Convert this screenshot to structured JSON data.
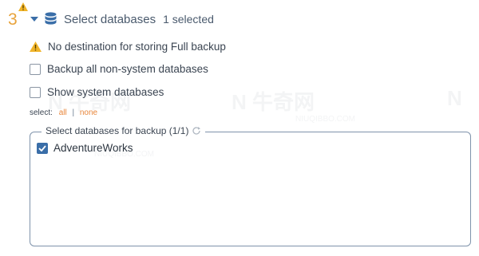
{
  "step": {
    "number": "3",
    "title": "Select databases",
    "subtitle": "1 selected"
  },
  "warning": {
    "text": "No destination for storing Full backup"
  },
  "options": {
    "backup_all_label": "Backup all non-system databases",
    "show_system_label": "Show system databases"
  },
  "select_links": {
    "prefix": "select:",
    "all": "all",
    "separator": "|",
    "none": "none"
  },
  "databases_box": {
    "legend": "Select databases for backup (1/1)",
    "items": [
      {
        "label": "AdventureWorks",
        "checked": true
      }
    ]
  },
  "watermark": {
    "text": "牛奇网",
    "url": "NIUQIBBO.COM"
  },
  "colors": {
    "accent_orange": "#e8a33b",
    "checkbox_blue": "#3a6ea8",
    "text": "#3b4552",
    "border": "#7f93ab"
  }
}
